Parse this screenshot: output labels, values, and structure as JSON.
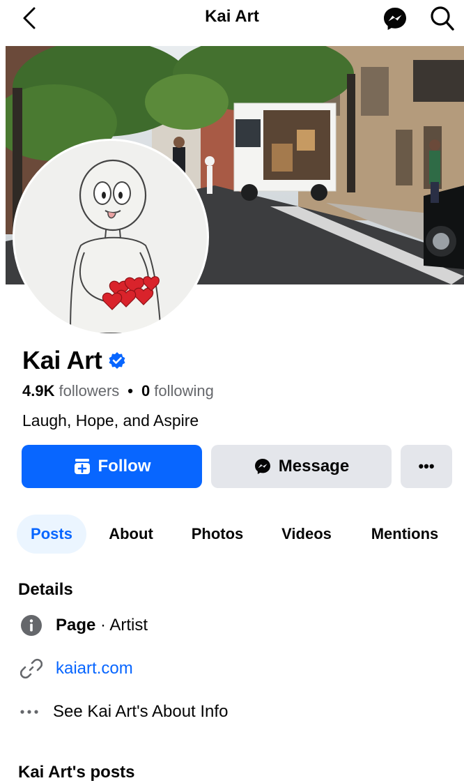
{
  "header": {
    "title": "Kai Art",
    "back_icon": "chevron-left-icon",
    "messenger_icon": "messenger-icon",
    "search_icon": "search-icon"
  },
  "profile": {
    "name": "Kai Art",
    "verified": true,
    "followers_count": "4.9K",
    "followers_label": "followers",
    "separator": "•",
    "following_count": "0",
    "following_label": "following",
    "bio": "Laugh, Hope, and Aspire"
  },
  "actions": {
    "follow_label": "Follow",
    "message_label": "Message",
    "more_label": "•••"
  },
  "tabs": [
    {
      "label": "Posts",
      "active": true
    },
    {
      "label": "About",
      "active": false
    },
    {
      "label": "Photos",
      "active": false
    },
    {
      "label": "Videos",
      "active": false
    },
    {
      "label": "Mentions",
      "active": false
    }
  ],
  "details": {
    "title": "Details",
    "category_bold": "Page",
    "category_rest": " · Artist",
    "website": "kaiart.com",
    "about_info": "See Kai Art's About Info"
  },
  "posts_section": {
    "title": "Kai Art's posts"
  },
  "colors": {
    "accent": "#0866ff",
    "button_gray": "#e4e6eb",
    "secondary_text": "#65676b",
    "active_tab_bg": "#ebf5ff"
  }
}
